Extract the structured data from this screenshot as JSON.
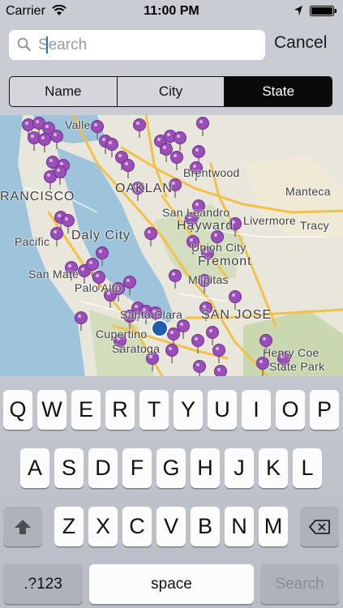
{
  "status_bar": {
    "carrier": "Carrier",
    "time": "11:00 PM"
  },
  "search": {
    "placeholder": "Search",
    "value": "",
    "cancel_label": "Cancel"
  },
  "segments": {
    "items": [
      "Name",
      "City",
      "State"
    ],
    "selected": "State"
  },
  "map": {
    "labels": {
      "vallejo": "Valle",
      "francisco": "RANCISCO",
      "oakland": "OAKLAN",
      "brentwood": "Brentwood",
      "manteca": "Manteca",
      "san_leandro": "San Leandro",
      "hayward": "Hayward",
      "livermore": "Livermore",
      "tracy": "Tracy",
      "daly_city": "Daly City",
      "pacifica": "Pacific",
      "union_city": "Union City",
      "fremont": "Fremont",
      "san_mateo": "San Mate",
      "palo_alto": "Palo Alto",
      "milpitas": "Milpitas",
      "san_jose": "SAN JOSE",
      "santa_clara": "Santa Clara",
      "cupertino": "Cupertino",
      "saratoga": "Saratoga",
      "henry_coe": "Henry Coe",
      "state_park": "State Park"
    }
  },
  "keyboard": {
    "row1": [
      "Q",
      "W",
      "E",
      "R",
      "T",
      "Y",
      "U",
      "I",
      "O",
      "P"
    ],
    "row2": [
      "A",
      "S",
      "D",
      "F",
      "G",
      "H",
      "J",
      "K",
      "L"
    ],
    "row3": [
      "Z",
      "X",
      "C",
      "V",
      "B",
      "N",
      "M"
    ],
    "numbers_label": ".?123",
    "space_label": "space",
    "search_label": "Search"
  }
}
